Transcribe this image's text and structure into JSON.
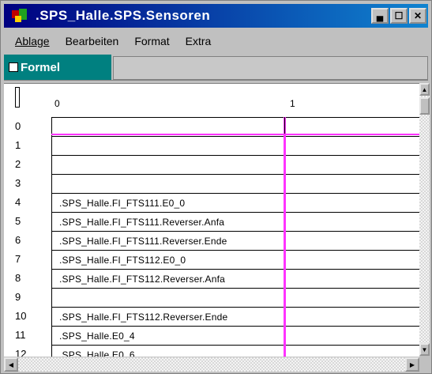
{
  "window": {
    "title": ".SPS_Halle.SPS.Sensoren"
  },
  "menubar": {
    "items": [
      "Ablage",
      "Bearbeiten",
      "Format",
      "Extra"
    ]
  },
  "tabbar": {
    "active_tab": "Formel"
  },
  "ruler": {
    "columns": [
      "0",
      "1"
    ]
  },
  "rows": [
    {
      "num": "0",
      "text": ""
    },
    {
      "num": "1",
      "text": ""
    },
    {
      "num": "2",
      "text": ""
    },
    {
      "num": "3",
      "text": ""
    },
    {
      "num": "4",
      "text": ".SPS_Halle.FI_FTS111.E0_0"
    },
    {
      "num": "5",
      "text": ".SPS_Halle.FI_FTS111.Reverser.Anfa"
    },
    {
      "num": "6",
      "text": ".SPS_Halle.FI_FTS111.Reverser.Ende"
    },
    {
      "num": "7",
      "text": ".SPS_Halle.FI_FTS112.E0_0"
    },
    {
      "num": "8",
      "text": ".SPS_Halle.FI_FTS112.Reverser.Anfa"
    },
    {
      "num": "9",
      "text": ""
    },
    {
      "num": "10",
      "text": ".SPS_Halle.FI_FTS112.Reverser.Ende"
    },
    {
      "num": "11",
      "text": ".SPS_Halle.E0_4"
    },
    {
      "num": "12",
      "text": ".SPS_Halle.E0_6"
    }
  ],
  "colors": {
    "title_bar": "#000080",
    "tab_active": "#008080",
    "cursor_line": "#ff33ff"
  }
}
